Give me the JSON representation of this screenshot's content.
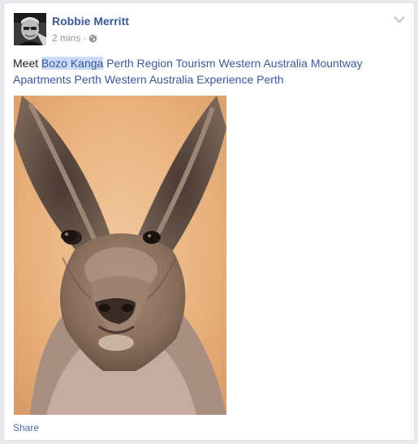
{
  "post": {
    "author": "Robbie Merritt",
    "time": "2 mins",
    "separator": "·",
    "privacy_icon": "globe-icon",
    "menu_icon": "chevron-down-icon",
    "text_intro": "Meet",
    "mentions": [
      "Bozo Kanga",
      "Perth Region Tourism Western Australia",
      "Mountway Apartments Perth Western Australia",
      "Experience Perth"
    ],
    "photo_subject": "kangaroo-photo",
    "share_label": "Share"
  },
  "colors": {
    "link": "#3b5998",
    "highlight": "#c9dbf9",
    "meta": "#90949c",
    "background": "#e9eaed"
  }
}
